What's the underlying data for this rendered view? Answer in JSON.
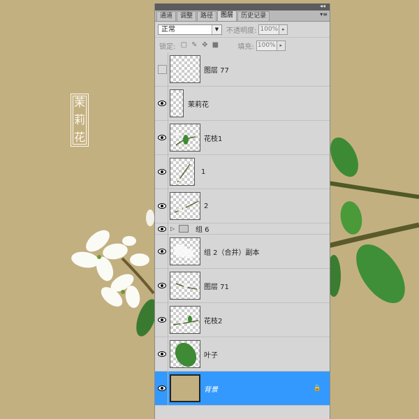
{
  "seal": {
    "chars": [
      "茉",
      "莉",
      "花"
    ]
  },
  "panel": {
    "tabs": [
      {
        "label": "通道",
        "active": false
      },
      {
        "label": "调整",
        "active": false
      },
      {
        "label": "路径",
        "active": false
      },
      {
        "label": "图层",
        "active": true
      },
      {
        "label": "历史记录",
        "active": false
      }
    ],
    "blend_mode": "正常",
    "opacity_label": "不透明度:",
    "opacity_value": "100%",
    "lock_label": "锁定:",
    "fill_label": "填充:",
    "fill_value": "100%",
    "layers": [
      {
        "name": "图层 77",
        "visible": false
      },
      {
        "name": "茉莉花",
        "visible": true
      },
      {
        "name": "花枝1",
        "visible": true
      },
      {
        "name": "1",
        "visible": true
      },
      {
        "name": "2",
        "visible": true
      },
      {
        "name": "组 6",
        "visible": true
      },
      {
        "name": "组 2（合并）副本",
        "visible": true
      },
      {
        "name": "图层 71",
        "visible": true
      },
      {
        "name": "花枝2",
        "visible": true
      },
      {
        "name": "叶子",
        "visible": true
      },
      {
        "name": "背景",
        "visible": true,
        "selected": true
      }
    ]
  }
}
